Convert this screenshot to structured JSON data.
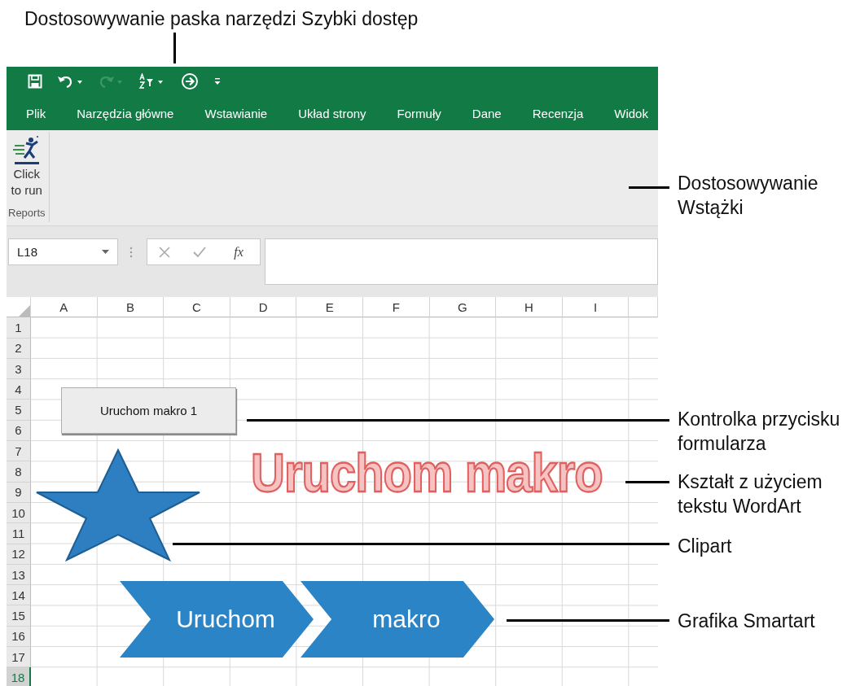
{
  "quick_access_toolbar": [
    {
      "kind": "save",
      "disabled": false
    },
    {
      "kind": "undo",
      "disabled": false
    },
    {
      "kind": "redo",
      "disabled": true
    },
    {
      "kind": "sort",
      "disabled": false
    },
    {
      "kind": "run",
      "disabled": false
    },
    {
      "kind": "customize",
      "disabled": false
    }
  ],
  "ribbon_tabs": [
    {
      "label": "Plik",
      "selected": false
    },
    {
      "label": "Narzędzia główne",
      "selected": false
    },
    {
      "label": "Wstawianie",
      "selected": false
    },
    {
      "label": "Układ strony",
      "selected": false
    },
    {
      "label": "Formuły",
      "selected": false
    },
    {
      "label": "Dane",
      "selected": false
    },
    {
      "label": "Recenzja",
      "selected": false
    },
    {
      "label": "Widok",
      "selected": false
    }
  ],
  "ribbon": {
    "groups": [
      {
        "label": "Reports",
        "buttons": [
          {
            "label": "Click to run"
          }
        ]
      }
    ]
  },
  "formula_bar": {
    "name_box": "L18",
    "function_label": "fx"
  },
  "sheet": {
    "columns": [
      "A",
      "B",
      "C",
      "D",
      "E",
      "F",
      "G",
      "H",
      "I"
    ],
    "rows": [
      {
        "label": "1",
        "selected": false
      },
      {
        "label": "2",
        "selected": false
      },
      {
        "label": "3",
        "selected": false
      },
      {
        "label": "4",
        "selected": false
      },
      {
        "label": "5",
        "selected": false
      },
      {
        "label": "6",
        "selected": false
      },
      {
        "label": "7",
        "selected": false
      },
      {
        "label": "8",
        "selected": false
      },
      {
        "label": "9",
        "selected": false
      },
      {
        "label": "10",
        "selected": false
      },
      {
        "label": "11",
        "selected": false
      },
      {
        "label": "12",
        "selected": false
      },
      {
        "label": "13",
        "selected": false
      },
      {
        "label": "14",
        "selected": false
      },
      {
        "label": "15",
        "selected": false
      },
      {
        "label": "16",
        "selected": false
      },
      {
        "label": "17",
        "selected": false
      },
      {
        "label": "18",
        "selected": true
      }
    ],
    "form_button": "Uruchom makro 1",
    "wordart": "Uruchom makro",
    "smartart": [
      "Uruchom",
      "makro"
    ]
  },
  "annotations": [
    {
      "text": "Dostosowywanie paska narzędzi Szybki dostęp"
    },
    {
      "text": "Dostosowywanie\nWstążki"
    },
    {
      "text": "Kontrolka przycisku\nformularza"
    },
    {
      "text": "Kształt z użyciem\ntekstu WordArt"
    },
    {
      "text": "Clipart"
    },
    {
      "text": "Grafika Smartart"
    }
  ]
}
